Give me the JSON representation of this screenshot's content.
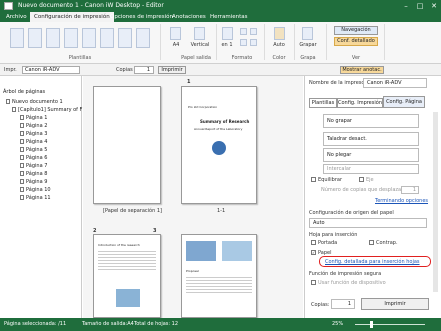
{
  "window": {
    "title": "Nuevo documento 1 - Canon iW Desktop - Editor"
  },
  "ribbon_tabs": [
    "Archivo",
    "Configuración de impresión",
    "Opciones de impresión",
    "Anotaciones",
    "Herramientas"
  ],
  "ribbon": {
    "plantillas_label": "Plantillas",
    "papel_a4": "A4",
    "vertical": "Vertical",
    "papel_salida_label": "Papel salida",
    "formato_value": "en 1",
    "formato_label": "Formato",
    "color_value": "Auto",
    "color_label": "Color",
    "grapa_value": "Grapar",
    "grapa_label": "Grapa",
    "navegacion": "Navegación",
    "config_detallada": "Conf. detallado",
    "ver_label": "Ver"
  },
  "toolbar": {
    "impr_label": "Impr.",
    "impr_value": "Canon iR-ADV",
    "copias_label": "Copias",
    "copias_value": "1",
    "imprimir": "Imprimir",
    "mostrar": "Mostrar anotac."
  },
  "tree": {
    "title": "Árbol de páginas",
    "root": "Nuevo documento 1",
    "sub": "[Capítulo1] Summary of F",
    "pages": [
      "Página 1",
      "Página 2",
      "Página 3",
      "Página 4",
      "Página 5",
      "Página 6",
      "Página 7",
      "Página 8",
      "Página 9",
      "Página 10",
      "Página 11"
    ]
  },
  "center": {
    "page1_num": "1",
    "sep_caption": "[Papel de separación 1]",
    "cap_1_1": "1-1",
    "page2_num": "2",
    "page3_num": "3",
    "doc_company": "Pro Ltd Corporation",
    "doc_title": "Summary of Research",
    "doc_sub": "Annual Report of the Laboratory",
    "p2_heading": "Introduction of the research",
    "p3_heading": "Proposal"
  },
  "right": {
    "printer_label": "Nombre de la impresora",
    "printer_value": "Canon iR-ADV",
    "tabs": [
      "Plantillas",
      "Config. Impresión",
      "Config. Página"
    ],
    "grapar": "No grapar",
    "taladrar": "Taladrar desact.",
    "plegar": "No plegar",
    "intercalar": "Intercalar",
    "equilibrar": "Equilibrar",
    "eje": "Eje",
    "copias_desplazar": "Número de copias que desplazar",
    "desplazar_value": "1",
    "terminando": "Terminando opciones",
    "origen_label": "Configuración de origen del papel",
    "origen_value": "Auto",
    "hoja_label": "Hoja para inserción",
    "portada": "Portada",
    "contrap": "Contrap.",
    "papel": "Papel",
    "config_insercion": "Config. detallada para inserción hojas",
    "funcion_label": "Función de impresión segura",
    "usar_funcion": "Usar función de dispositivo",
    "copias_label": "Copias:",
    "copias_value": "1",
    "imprimir": "Imprimir"
  },
  "status": {
    "sel": "Página seleccionada: /11",
    "tamano": "Tamaño de salida:A4",
    "total": "Total de hojas: 12",
    "zoom": "25%"
  }
}
